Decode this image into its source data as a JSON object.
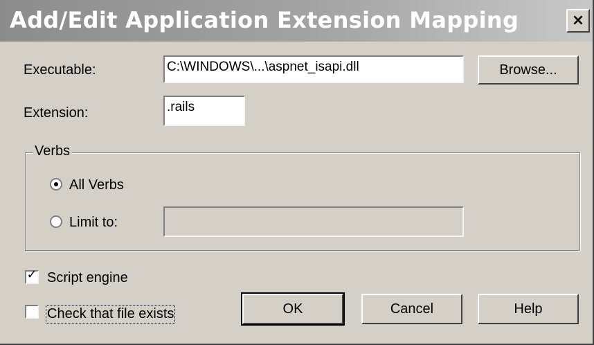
{
  "dialog": {
    "title": "Add/Edit Application Extension Mapping",
    "close_glyph": "×"
  },
  "executable": {
    "label": "Executable:",
    "value": "C:\\WINDOWS\\...\\aspnet_isapi.dll",
    "browse_label": "Browse..."
  },
  "extension": {
    "label": "Extension:",
    "value": ".rails"
  },
  "verbs": {
    "group_label": "Verbs",
    "all_verbs_label": "All Verbs",
    "all_verbs_selected": true,
    "limit_to_label": "Limit to:",
    "limit_to_selected": false,
    "limit_to_value": ""
  },
  "options": {
    "script_engine_label": "Script engine",
    "script_engine_checked": true,
    "check_file_label": "Check that file exists",
    "check_file_checked": false,
    "check_mark_glyph": "✓"
  },
  "buttons": {
    "ok": "OK",
    "cancel": "Cancel",
    "help": "Help"
  },
  "colors": {
    "face": "#d4d0c8",
    "titlebar": "#9a9a9a"
  }
}
